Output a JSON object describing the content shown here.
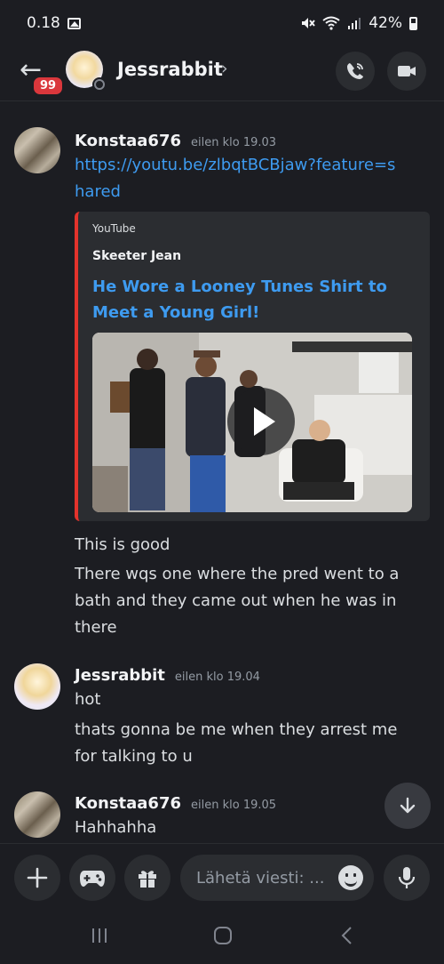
{
  "status_bar": {
    "time": "0.18",
    "battery": "42%"
  },
  "header": {
    "back_label": "←",
    "unread_badge": "99",
    "title": "Jessrabbit",
    "chevron": "›"
  },
  "messages": [
    {
      "author": "Konstaa676",
      "time": "eilen klo 19.03",
      "link": "https://youtu.be/zlbqtBCBjaw?feature=shared",
      "embed": {
        "provider": "YouTube",
        "author": "Skeeter Jean",
        "title": "He Wore a Looney Tunes Shirt to Meet a Young Girl!"
      },
      "lines": [
        "This is good",
        "There wqs one where the pred went to a bath and they came out when he was in there"
      ]
    },
    {
      "author": "Jessrabbit",
      "time": "eilen klo 19.04",
      "lines": [
        "hot",
        "thats gonna be me when they arrest me for talking to u"
      ]
    },
    {
      "author": "Konstaa676",
      "time": "eilen klo 19.05",
      "lines": [
        "Hahhahha"
      ]
    }
  ],
  "composer": {
    "placeholder": "Lähetä viesti: ..."
  },
  "colors": {
    "background": "#1c1d22",
    "link": "#3e9bf0",
    "badge": "#da373c",
    "embed_bar": "#e3332c"
  },
  "icons": [
    "image-icon",
    "mute-icon",
    "wifi-icon",
    "signal-icon",
    "battery-icon",
    "back-arrow-icon",
    "call-icon",
    "video-icon",
    "plus-icon",
    "gamepad-icon",
    "gift-icon",
    "emoji-icon",
    "microphone-icon",
    "recent-apps-icon",
    "home-icon",
    "back-nav-icon",
    "chevron-down-icon",
    "play-icon"
  ]
}
